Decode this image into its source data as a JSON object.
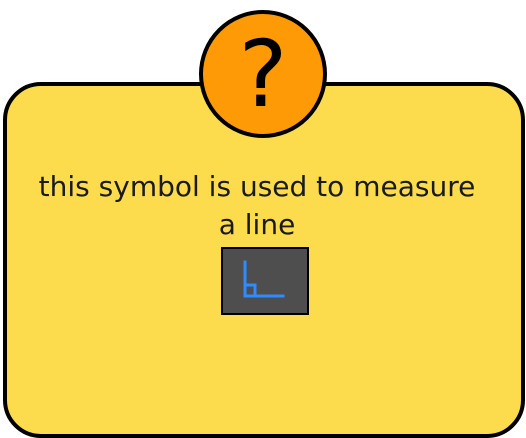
{
  "badge": {
    "glyph": "?",
    "icon": "question-mark-icon",
    "color": "#fd9a06"
  },
  "card": {
    "message_line1": "this symbol is used to measure",
    "message_line2": "a line",
    "background": "#fcdc4d"
  },
  "symbol": {
    "icon": "right-angle-measure-icon",
    "stroke_color": "#2f8bff",
    "box_color": "#4e4e4e"
  }
}
